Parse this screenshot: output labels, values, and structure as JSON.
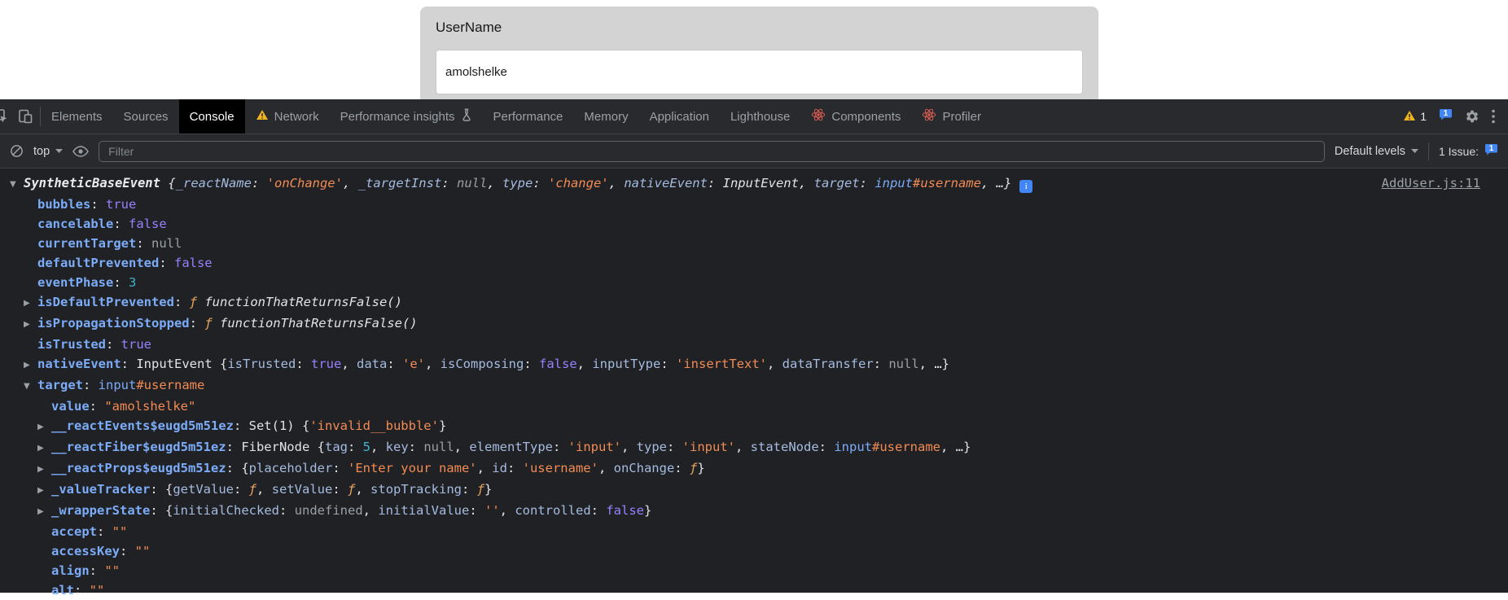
{
  "colors": {
    "devtools_bg": "#202124",
    "chrome_bar_bg": "#292a2d",
    "key_blue": "#7cacf8",
    "string_orange": "#f28b54",
    "boolean_purple": "#9980ff",
    "number_teal": "#3fb5cf",
    "warning_yellow": "#f0b421",
    "issue_blue": "#4285f4"
  },
  "page": {
    "card": {
      "label": "UserName",
      "input_value": "amolshelke"
    }
  },
  "devtools": {
    "tabs": [
      "Elements",
      "Sources",
      "Console",
      "Network",
      "Performance insights",
      "Performance",
      "Memory",
      "Application",
      "Lighthouse",
      "Components",
      "Profiler"
    ],
    "active_tab": "Console",
    "badges": {
      "warnings": "1",
      "issues": "1"
    },
    "toolbar": {
      "context": "top",
      "filter_placeholder": "Filter",
      "levels": "Default levels",
      "issue_label": "1 Issue:",
      "issue_count": "1"
    },
    "icons": {
      "collapse": "▼",
      "expand": "▶"
    },
    "console": {
      "lines": [
        {
          "indent": 0,
          "arrow": "down",
          "italic": true,
          "info": true,
          "link": "AddUser.js:11",
          "tokens": [
            {
              "t": "SyntheticBaseEvent ",
              "s": "obj"
            },
            {
              "t": "{",
              "s": "d"
            },
            {
              "t": "_reactName",
              "s": "pk"
            },
            {
              "t": ": ",
              "s": "d"
            },
            {
              "t": "'onChange'",
              "s": "s"
            },
            {
              "t": ", ",
              "s": "d"
            },
            {
              "t": "_targetInst",
              "s": "pk"
            },
            {
              "t": ": ",
              "s": "d"
            },
            {
              "t": "null",
              "s": "u"
            },
            {
              "t": ", ",
              "s": "d"
            },
            {
              "t": "type",
              "s": "pk"
            },
            {
              "t": ": ",
              "s": "d"
            },
            {
              "t": "'change'",
              "s": "s"
            },
            {
              "t": ", ",
              "s": "d"
            },
            {
              "t": "nativeEvent",
              "s": "pk"
            },
            {
              "t": ": ",
              "s": "d"
            },
            {
              "t": "InputEvent",
              "s": "d"
            },
            {
              "t": ", ",
              "s": "d"
            },
            {
              "t": "target",
              "s": "pk"
            },
            {
              "t": ": ",
              "s": "d"
            },
            {
              "t": "input",
              "s": "tag"
            },
            {
              "t": "#username",
              "s": "s"
            },
            {
              "t": ", ",
              "s": "d"
            },
            {
              "t": "…}",
              "s": "d"
            }
          ]
        },
        {
          "indent": 1,
          "tokens": [
            {
              "t": "bubbles",
              "s": "k"
            },
            {
              "t": ": ",
              "s": "d"
            },
            {
              "t": "true",
              "s": "b"
            }
          ]
        },
        {
          "indent": 1,
          "tokens": [
            {
              "t": "cancelable",
              "s": "k"
            },
            {
              "t": ": ",
              "s": "d"
            },
            {
              "t": "false",
              "s": "b"
            }
          ]
        },
        {
          "indent": 1,
          "tokens": [
            {
              "t": "currentTarget",
              "s": "k"
            },
            {
              "t": ": ",
              "s": "d"
            },
            {
              "t": "null",
              "s": "u"
            }
          ]
        },
        {
          "indent": 1,
          "tokens": [
            {
              "t": "defaultPrevented",
              "s": "k"
            },
            {
              "t": ": ",
              "s": "d"
            },
            {
              "t": "false",
              "s": "b"
            }
          ]
        },
        {
          "indent": 1,
          "tokens": [
            {
              "t": "eventPhase",
              "s": "k"
            },
            {
              "t": ": ",
              "s": "d"
            },
            {
              "t": "3",
              "s": "n"
            }
          ]
        },
        {
          "indent": 1,
          "arrow": "right",
          "tokens": [
            {
              "t": "isDefaultPrevented",
              "s": "k"
            },
            {
              "t": ": ",
              "s": "d"
            },
            {
              "t": "ƒ ",
              "s": "f"
            },
            {
              "t": "functionThatReturnsFalse()",
              "s": "fi"
            }
          ]
        },
        {
          "indent": 1,
          "arrow": "right",
          "tokens": [
            {
              "t": "isPropagationStopped",
              "s": "k"
            },
            {
              "t": ": ",
              "s": "d"
            },
            {
              "t": "ƒ ",
              "s": "f"
            },
            {
              "t": "functionThatReturnsFalse()",
              "s": "fi"
            }
          ]
        },
        {
          "indent": 1,
          "tokens": [
            {
              "t": "isTrusted",
              "s": "k"
            },
            {
              "t": ": ",
              "s": "d"
            },
            {
              "t": "true",
              "s": "b"
            }
          ]
        },
        {
          "indent": 1,
          "arrow": "right",
          "tokens": [
            {
              "t": "nativeEvent",
              "s": "k"
            },
            {
              "t": ": ",
              "s": "d"
            },
            {
              "t": "InputEvent ",
              "s": "d"
            },
            {
              "t": "{",
              "s": "d"
            },
            {
              "t": "isTrusted",
              "s": "pk"
            },
            {
              "t": ": ",
              "s": "d"
            },
            {
              "t": "true",
              "s": "b"
            },
            {
              "t": ", ",
              "s": "d"
            },
            {
              "t": "data",
              "s": "pk"
            },
            {
              "t": ": ",
              "s": "d"
            },
            {
              "t": "'e'",
              "s": "s"
            },
            {
              "t": ", ",
              "s": "d"
            },
            {
              "t": "isComposing",
              "s": "pk"
            },
            {
              "t": ": ",
              "s": "d"
            },
            {
              "t": "false",
              "s": "b"
            },
            {
              "t": ", ",
              "s": "d"
            },
            {
              "t": "inputType",
              "s": "pk"
            },
            {
              "t": ": ",
              "s": "d"
            },
            {
              "t": "'insertText'",
              "s": "s"
            },
            {
              "t": ", ",
              "s": "d"
            },
            {
              "t": "dataTransfer",
              "s": "pk"
            },
            {
              "t": ": ",
              "s": "d"
            },
            {
              "t": "null",
              "s": "u"
            },
            {
              "t": ", …}",
              "s": "d"
            }
          ]
        },
        {
          "indent": 1,
          "arrow": "down",
          "tokens": [
            {
              "t": "target",
              "s": "k"
            },
            {
              "t": ": ",
              "s": "d"
            },
            {
              "t": "input",
              "s": "tag"
            },
            {
              "t": "#username",
              "s": "s"
            }
          ]
        },
        {
          "indent": 2,
          "tokens": [
            {
              "t": "value",
              "s": "k"
            },
            {
              "t": ": ",
              "s": "d"
            },
            {
              "t": "\"amolshelke\"",
              "s": "s"
            }
          ]
        },
        {
          "indent": 2,
          "arrow": "right",
          "tokens": [
            {
              "t": "__reactEvents$eugd5m51ez",
              "s": "k"
            },
            {
              "t": ": ",
              "s": "d"
            },
            {
              "t": "Set(1) ",
              "s": "d"
            },
            {
              "t": "{",
              "s": "d"
            },
            {
              "t": "'invalid__bubble'",
              "s": "s"
            },
            {
              "t": "}",
              "s": "d"
            }
          ]
        },
        {
          "indent": 2,
          "arrow": "right",
          "tokens": [
            {
              "t": "__reactFiber$eugd5m51ez",
              "s": "k"
            },
            {
              "t": ": ",
              "s": "d"
            },
            {
              "t": "FiberNode ",
              "s": "d"
            },
            {
              "t": "{",
              "s": "d"
            },
            {
              "t": "tag",
              "s": "pk"
            },
            {
              "t": ": ",
              "s": "d"
            },
            {
              "t": "5",
              "s": "n"
            },
            {
              "t": ", ",
              "s": "d"
            },
            {
              "t": "key",
              "s": "pk"
            },
            {
              "t": ": ",
              "s": "d"
            },
            {
              "t": "null",
              "s": "u"
            },
            {
              "t": ", ",
              "s": "d"
            },
            {
              "t": "elementType",
              "s": "pk"
            },
            {
              "t": ": ",
              "s": "d"
            },
            {
              "t": "'input'",
              "s": "s"
            },
            {
              "t": ", ",
              "s": "d"
            },
            {
              "t": "type",
              "s": "pk"
            },
            {
              "t": ": ",
              "s": "d"
            },
            {
              "t": "'input'",
              "s": "s"
            },
            {
              "t": ", ",
              "s": "d"
            },
            {
              "t": "stateNode",
              "s": "pk"
            },
            {
              "t": ": ",
              "s": "d"
            },
            {
              "t": "input",
              "s": "tag"
            },
            {
              "t": "#username",
              "s": "s"
            },
            {
              "t": ", …}",
              "s": "d"
            }
          ]
        },
        {
          "indent": 2,
          "arrow": "right",
          "tokens": [
            {
              "t": "__reactProps$eugd5m51ez",
              "s": "k"
            },
            {
              "t": ": ",
              "s": "d"
            },
            {
              "t": "{",
              "s": "d"
            },
            {
              "t": "placeholder",
              "s": "pk"
            },
            {
              "t": ": ",
              "s": "d"
            },
            {
              "t": "'Enter your name'",
              "s": "s"
            },
            {
              "t": ", ",
              "s": "d"
            },
            {
              "t": "id",
              "s": "pk"
            },
            {
              "t": ": ",
              "s": "d"
            },
            {
              "t": "'username'",
              "s": "s"
            },
            {
              "t": ", ",
              "s": "d"
            },
            {
              "t": "onChange",
              "s": "pk"
            },
            {
              "t": ": ",
              "s": "d"
            },
            {
              "t": "ƒ",
              "s": "f"
            },
            {
              "t": "}",
              "s": "d"
            }
          ]
        },
        {
          "indent": 2,
          "arrow": "right",
          "tokens": [
            {
              "t": "_valueTracker",
              "s": "k"
            },
            {
              "t": ": ",
              "s": "d"
            },
            {
              "t": "{",
              "s": "d"
            },
            {
              "t": "getValue",
              "s": "pk"
            },
            {
              "t": ": ",
              "s": "d"
            },
            {
              "t": "ƒ",
              "s": "f"
            },
            {
              "t": ", ",
              "s": "d"
            },
            {
              "t": "setValue",
              "s": "pk"
            },
            {
              "t": ": ",
              "s": "d"
            },
            {
              "t": "ƒ",
              "s": "f"
            },
            {
              "t": ", ",
              "s": "d"
            },
            {
              "t": "stopTracking",
              "s": "pk"
            },
            {
              "t": ": ",
              "s": "d"
            },
            {
              "t": "ƒ",
              "s": "f"
            },
            {
              "t": "}",
              "s": "d"
            }
          ]
        },
        {
          "indent": 2,
          "arrow": "right",
          "tokens": [
            {
              "t": "_wrapperState",
              "s": "k"
            },
            {
              "t": ": ",
              "s": "d"
            },
            {
              "t": "{",
              "s": "d"
            },
            {
              "t": "initialChecked",
              "s": "pk"
            },
            {
              "t": ": ",
              "s": "d"
            },
            {
              "t": "undefined",
              "s": "u"
            },
            {
              "t": ", ",
              "s": "d"
            },
            {
              "t": "initialValue",
              "s": "pk"
            },
            {
              "t": ": ",
              "s": "d"
            },
            {
              "t": "''",
              "s": "s"
            },
            {
              "t": ", ",
              "s": "d"
            },
            {
              "t": "controlled",
              "s": "pk"
            },
            {
              "t": ": ",
              "s": "d"
            },
            {
              "t": "false",
              "s": "b"
            },
            {
              "t": "}",
              "s": "d"
            }
          ]
        },
        {
          "indent": 2,
          "tokens": [
            {
              "t": "accept",
              "s": "k"
            },
            {
              "t": ": ",
              "s": "d"
            },
            {
              "t": "\"\"",
              "s": "s"
            }
          ]
        },
        {
          "indent": 2,
          "tokens": [
            {
              "t": "accessKey",
              "s": "k"
            },
            {
              "t": ": ",
              "s": "d"
            },
            {
              "t": "\"\"",
              "s": "s"
            }
          ]
        },
        {
          "indent": 2,
          "tokens": [
            {
              "t": "align",
              "s": "k"
            },
            {
              "t": ": ",
              "s": "d"
            },
            {
              "t": "\"\"",
              "s": "s"
            }
          ]
        },
        {
          "indent": 2,
          "tokens": [
            {
              "t": "alt",
              "s": "k"
            },
            {
              "t": ": ",
              "s": "d"
            },
            {
              "t": "\"\"",
              "s": "s"
            }
          ]
        }
      ]
    }
  }
}
